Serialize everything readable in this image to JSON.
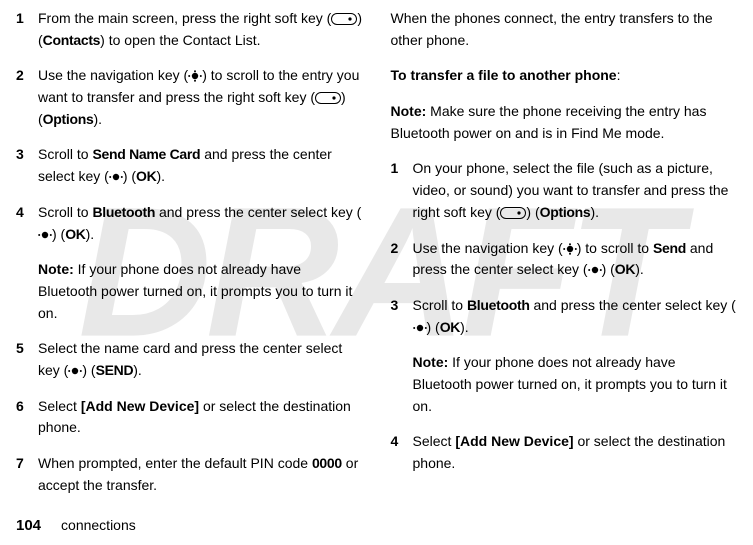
{
  "watermark": "DRAFT",
  "left": {
    "step1": {
      "num": "1",
      "pre": "From the main screen, press the right soft key (",
      "softLabel": "Contacts",
      "post": ") to open the Contact List."
    },
    "step2": {
      "num": "2",
      "pre": "Use the navigation key (",
      "mid": ") to scroll to the entry you want to transfer and press the right soft key (",
      "softLabel": "Options",
      "post": ")."
    },
    "step3": {
      "num": "3",
      "pre": "Scroll to ",
      "term": "Send Name Card",
      "mid": " and press the center select key (",
      "softLabel": "OK",
      "post": ")."
    },
    "step4": {
      "num": "4",
      "pre": "Scroll to ",
      "term": "Bluetooth",
      "mid": " and press the center select key (",
      "softLabel": "OK",
      "post": ")."
    },
    "note4": {
      "b": "Note:",
      "text": " If your phone does not already have Bluetooth power turned on, it prompts you to turn it on."
    },
    "step5": {
      "num": "5",
      "pre": "Select the name card and press the center select key (",
      "softLabel": "SEND",
      "post": ")."
    },
    "step6": {
      "num": "6",
      "pre": "Select ",
      "term": "[Add New Device]",
      "post": " or select the destination phone."
    },
    "step7": {
      "num": "7",
      "pre": "When prompted, enter the default PIN code ",
      "term": "0000",
      "post": " or accept the transfer."
    }
  },
  "right": {
    "intro": "When the phones connect, the entry transfers to the other phone.",
    "heading": "To transfer a file to another phone",
    "headingTail": ":",
    "note0": {
      "b": "Note:",
      "text": " Make sure the phone receiving the entry has Bluetooth power on and is in Find Me mode."
    },
    "step1": {
      "num": "1",
      "pre": "On your phone, select the file (such as a picture, video, or sound) you want to transfer and press the right soft key (",
      "softLabel": "Options",
      "post": ")."
    },
    "step2": {
      "num": "2",
      "pre": "Use the navigation key (",
      "mid": ") to scroll to ",
      "term": "Send",
      "mid2": " and press the center select key (",
      "softLabel": "OK",
      "post": ")."
    },
    "step3": {
      "num": "3",
      "pre": "Scroll to ",
      "term": "Bluetooth",
      "mid": " and press the center select key (",
      "softLabel": "OK",
      "post": ")."
    },
    "note3": {
      "b": "Note:",
      "text": " If your phone does not already have Bluetooth power turned on, it prompts you to turn it on."
    },
    "step4": {
      "num": "4",
      "pre": "Select ",
      "term": "[Add New Device]",
      "post": " or select the destination phone."
    }
  },
  "footer": {
    "page": "104",
    "section": "connections"
  }
}
